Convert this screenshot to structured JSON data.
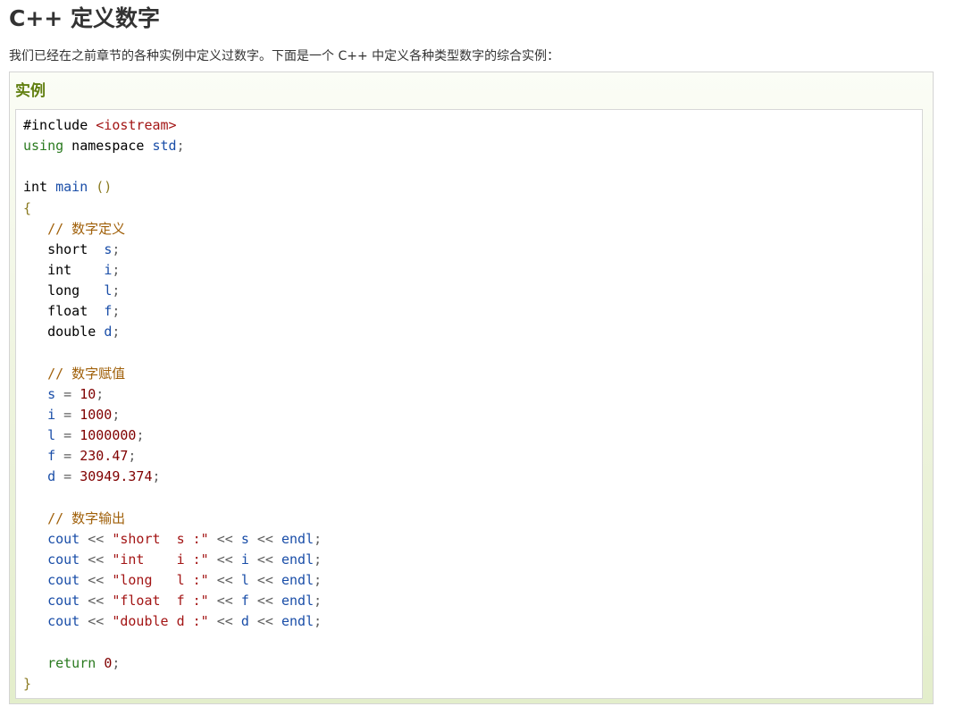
{
  "page": {
    "title": "C++ 定义数字",
    "intro": "我们已经在之前章节的各种实例中定义过数字。下面是一个 C++ 中定义各种类型数字的综合实例："
  },
  "example": {
    "label": "实例",
    "code_lines": [
      [
        {
          "t": "#include ",
          "c": "plain"
        },
        {
          "t": "<iostream>",
          "c": "string"
        }
      ],
      [
        {
          "t": "using",
          "c": "keyword"
        },
        {
          "t": " namespace ",
          "c": "plain"
        },
        {
          "t": "std",
          "c": "ident"
        },
        {
          "t": ";",
          "c": "punct"
        }
      ],
      [],
      [
        {
          "t": "int ",
          "c": "plain"
        },
        {
          "t": "main",
          "c": "ident"
        },
        {
          "t": " ",
          "c": "plain"
        },
        {
          "t": "()",
          "c": "bracket"
        }
      ],
      [
        {
          "t": "{",
          "c": "bracket"
        }
      ],
      [
        {
          "t": "   ",
          "c": "plain"
        },
        {
          "t": "// 数字定义",
          "c": "comment"
        }
      ],
      [
        {
          "t": "   short  ",
          "c": "plain"
        },
        {
          "t": "s",
          "c": "ident"
        },
        {
          "t": ";",
          "c": "punct"
        }
      ],
      [
        {
          "t": "   int    ",
          "c": "plain"
        },
        {
          "t": "i",
          "c": "ident"
        },
        {
          "t": ";",
          "c": "punct"
        }
      ],
      [
        {
          "t": "   long   ",
          "c": "plain"
        },
        {
          "t": "l",
          "c": "ident"
        },
        {
          "t": ";",
          "c": "punct"
        }
      ],
      [
        {
          "t": "   float  ",
          "c": "plain"
        },
        {
          "t": "f",
          "c": "ident"
        },
        {
          "t": ";",
          "c": "punct"
        }
      ],
      [
        {
          "t": "   double ",
          "c": "plain"
        },
        {
          "t": "d",
          "c": "ident"
        },
        {
          "t": ";",
          "c": "punct"
        }
      ],
      [],
      [
        {
          "t": "   ",
          "c": "plain"
        },
        {
          "t": "// 数字赋值",
          "c": "comment"
        }
      ],
      [
        {
          "t": "   ",
          "c": "plain"
        },
        {
          "t": "s",
          "c": "ident"
        },
        {
          "t": " = ",
          "c": "punct"
        },
        {
          "t": "10",
          "c": "number"
        },
        {
          "t": ";",
          "c": "punct"
        }
      ],
      [
        {
          "t": "   ",
          "c": "plain"
        },
        {
          "t": "i",
          "c": "ident"
        },
        {
          "t": " = ",
          "c": "punct"
        },
        {
          "t": "1000",
          "c": "number"
        },
        {
          "t": ";",
          "c": "punct"
        }
      ],
      [
        {
          "t": "   ",
          "c": "plain"
        },
        {
          "t": "l",
          "c": "ident"
        },
        {
          "t": " = ",
          "c": "punct"
        },
        {
          "t": "1000000",
          "c": "number"
        },
        {
          "t": ";",
          "c": "punct"
        }
      ],
      [
        {
          "t": "   ",
          "c": "plain"
        },
        {
          "t": "f",
          "c": "ident"
        },
        {
          "t": " = ",
          "c": "punct"
        },
        {
          "t": "230.47",
          "c": "number"
        },
        {
          "t": ";",
          "c": "punct"
        }
      ],
      [
        {
          "t": "   ",
          "c": "plain"
        },
        {
          "t": "d",
          "c": "ident"
        },
        {
          "t": " = ",
          "c": "punct"
        },
        {
          "t": "30949.374",
          "c": "number"
        },
        {
          "t": ";",
          "c": "punct"
        }
      ],
      [],
      [
        {
          "t": "   ",
          "c": "plain"
        },
        {
          "t": "// 数字输出",
          "c": "comment"
        }
      ],
      [
        {
          "t": "   ",
          "c": "plain"
        },
        {
          "t": "cout",
          "c": "ident"
        },
        {
          "t": " << ",
          "c": "punct"
        },
        {
          "t": "\"short  s :\"",
          "c": "string"
        },
        {
          "t": " << ",
          "c": "punct"
        },
        {
          "t": "s",
          "c": "ident"
        },
        {
          "t": " << ",
          "c": "punct"
        },
        {
          "t": "endl",
          "c": "ident"
        },
        {
          "t": ";",
          "c": "punct"
        }
      ],
      [
        {
          "t": "   ",
          "c": "plain"
        },
        {
          "t": "cout",
          "c": "ident"
        },
        {
          "t": " << ",
          "c": "punct"
        },
        {
          "t": "\"int    i :\"",
          "c": "string"
        },
        {
          "t": " << ",
          "c": "punct"
        },
        {
          "t": "i",
          "c": "ident"
        },
        {
          "t": " << ",
          "c": "punct"
        },
        {
          "t": "endl",
          "c": "ident"
        },
        {
          "t": ";",
          "c": "punct"
        }
      ],
      [
        {
          "t": "   ",
          "c": "plain"
        },
        {
          "t": "cout",
          "c": "ident"
        },
        {
          "t": " << ",
          "c": "punct"
        },
        {
          "t": "\"long   l :\"",
          "c": "string"
        },
        {
          "t": " << ",
          "c": "punct"
        },
        {
          "t": "l",
          "c": "ident"
        },
        {
          "t": " << ",
          "c": "punct"
        },
        {
          "t": "endl",
          "c": "ident"
        },
        {
          "t": ";",
          "c": "punct"
        }
      ],
      [
        {
          "t": "   ",
          "c": "plain"
        },
        {
          "t": "cout",
          "c": "ident"
        },
        {
          "t": " << ",
          "c": "punct"
        },
        {
          "t": "\"float  f :\"",
          "c": "string"
        },
        {
          "t": " << ",
          "c": "punct"
        },
        {
          "t": "f",
          "c": "ident"
        },
        {
          "t": " << ",
          "c": "punct"
        },
        {
          "t": "endl",
          "c": "ident"
        },
        {
          "t": ";",
          "c": "punct"
        }
      ],
      [
        {
          "t": "   ",
          "c": "plain"
        },
        {
          "t": "cout",
          "c": "ident"
        },
        {
          "t": " << ",
          "c": "punct"
        },
        {
          "t": "\"double d :\"",
          "c": "string"
        },
        {
          "t": " << ",
          "c": "punct"
        },
        {
          "t": "d",
          "c": "ident"
        },
        {
          "t": " << ",
          "c": "punct"
        },
        {
          "t": "endl",
          "c": "ident"
        },
        {
          "t": ";",
          "c": "punct"
        }
      ],
      [],
      [
        {
          "t": "   ",
          "c": "plain"
        },
        {
          "t": "return",
          "c": "keyword"
        },
        {
          "t": " ",
          "c": "plain"
        },
        {
          "t": "0",
          "c": "number"
        },
        {
          "t": ";",
          "c": "punct"
        }
      ],
      [
        {
          "t": "}",
          "c": "bracket"
        }
      ]
    ]
  },
  "colors": {
    "label_green": "#617f10",
    "string": "#a31515",
    "keyword": "#2a7a1f",
    "identifier": "#1a4ea8",
    "number": "#800000",
    "comment": "#a0600a"
  }
}
